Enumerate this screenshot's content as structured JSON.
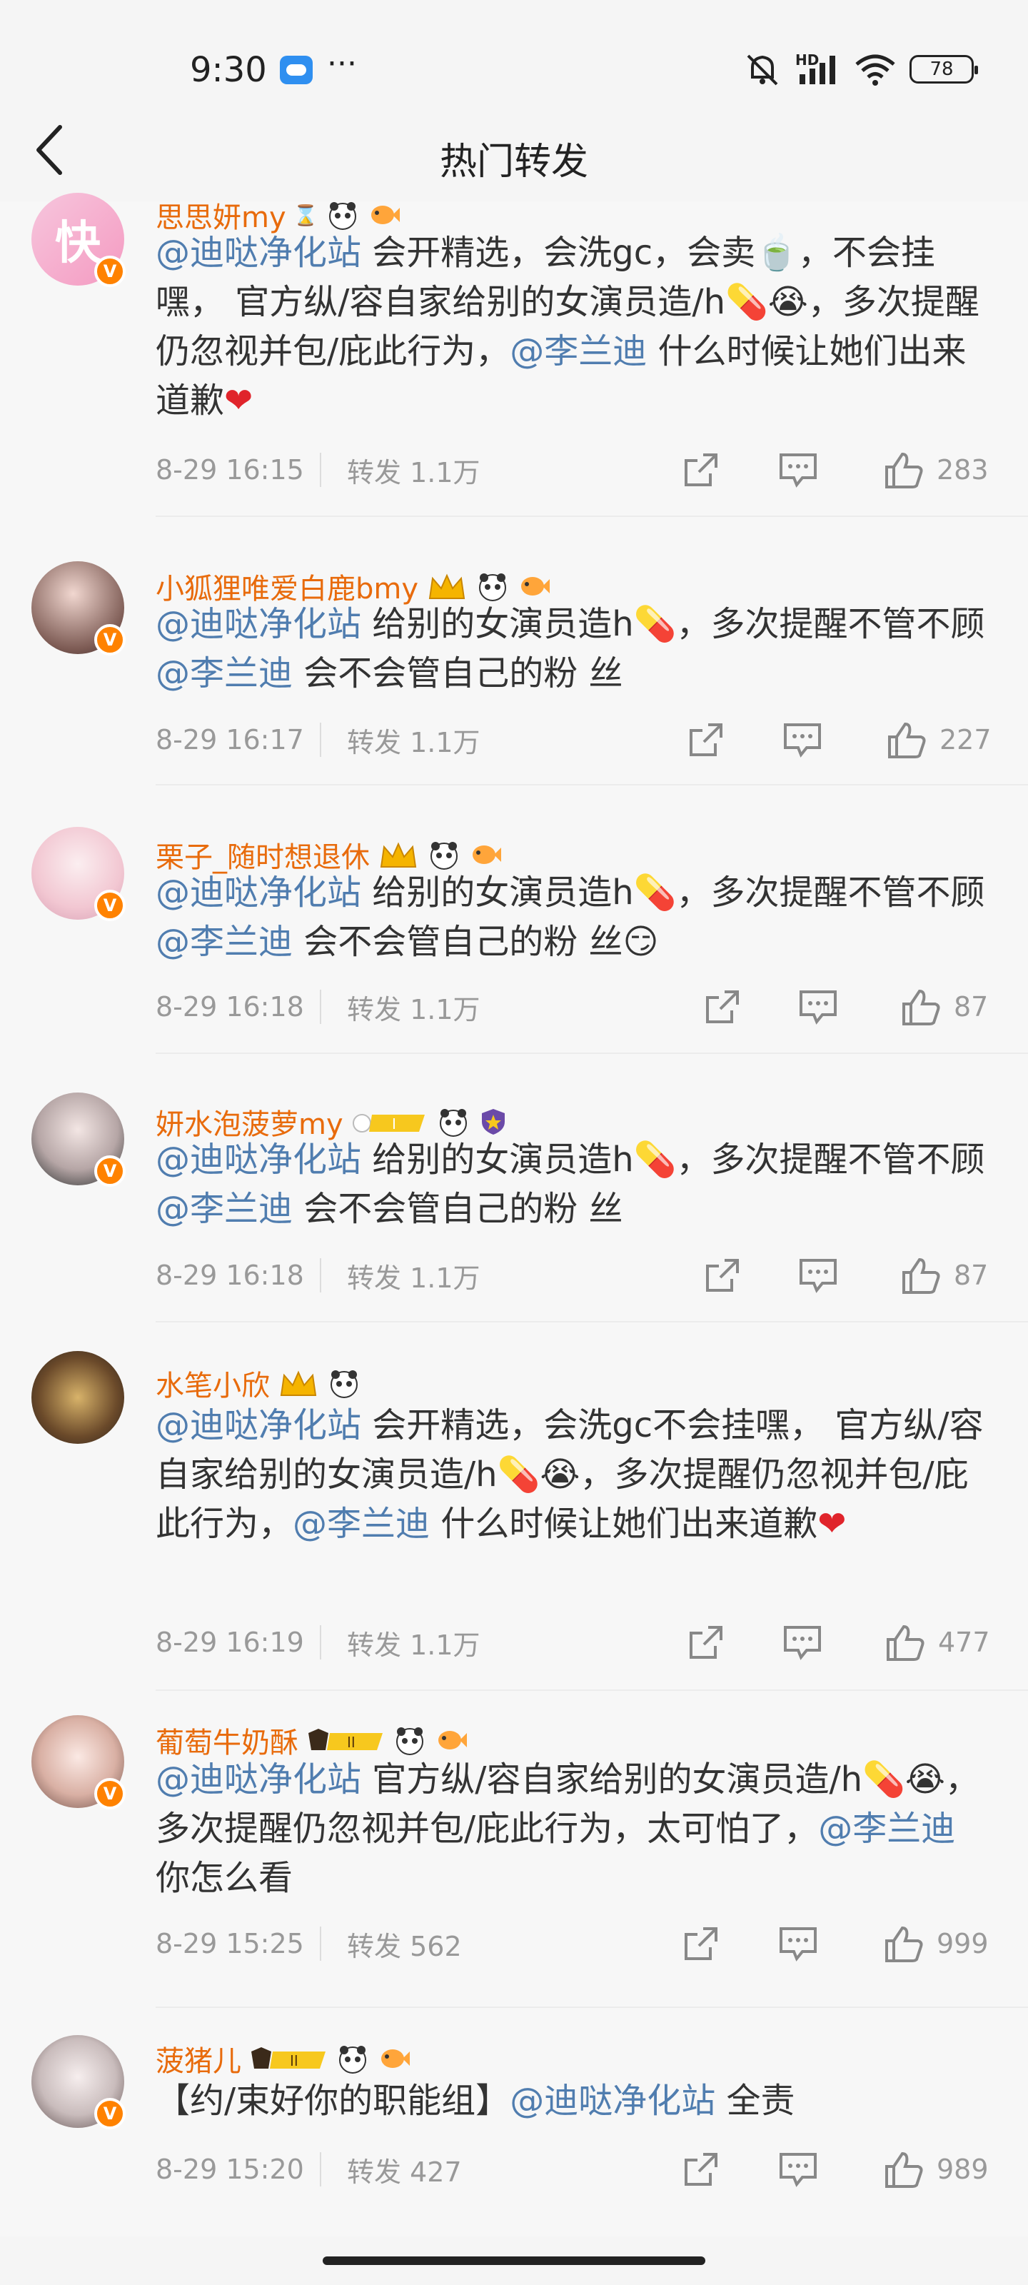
{
  "status": {
    "time": "9:30",
    "network": "HD",
    "battery": "78"
  },
  "nav": {
    "title": "热门转发"
  },
  "labels": {
    "repost_prefix": "转发"
  },
  "comments": [
    {
      "username": "思思妍my",
      "badges": [
        "hourglass-icon",
        "panda-icon",
        "fish-icon"
      ],
      "time": "8-29 16:15",
      "reposts": "1.1万",
      "likes": "283"
    },
    {
      "username": "小狐狸唯爱白鹿bmy",
      "badges": [
        "crown-icon",
        "panda-icon",
        "fish-icon"
      ],
      "time": "8-29 16:17",
      "reposts": "1.1万",
      "likes": "227"
    },
    {
      "username": "栗子_随时想退休",
      "badges": [
        "crown-icon",
        "panda-icon",
        "fish-icon"
      ],
      "time": "8-29 16:18",
      "reposts": "1.1万",
      "likes": "87"
    },
    {
      "username": "妍水泡菠萝my",
      "badges": [
        "level-badge-icon",
        "panda-icon",
        "shield-icon"
      ],
      "time": "8-29 16:18",
      "reposts": "1.1万",
      "likes": "87"
    },
    {
      "username": "水笔小欣",
      "badges": [
        "crown-icon",
        "panda-icon"
      ],
      "time": "8-29 16:19",
      "reposts": "1.1万",
      "likes": "477"
    },
    {
      "username": "葡萄牛奶酥",
      "badges": [
        "vip-ii-badge-icon",
        "panda-icon",
        "fish-icon"
      ],
      "time": "8-29 15:25",
      "reposts": "562",
      "likes": "999"
    },
    {
      "username": "菠猪儿",
      "badges": [
        "vip-ii-badge-icon",
        "panda-icon",
        "fish-icon"
      ],
      "time": "8-29 15:20",
      "reposts": "427",
      "likes": "989"
    }
  ],
  "text": {
    "c0": {
      "m1": "@迪哒净化站",
      "t1": " 会开精选，会洗gc，会卖",
      "t2": "，不会挂嘿，  官方纵/容自家给别的女演员造/h",
      "t3": "，多次提醒仍忽视并包/庇此行为，",
      "m2": "@李兰迪",
      "t4": " 什么时候让她们出来道歉"
    },
    "c1": {
      "m1": "@迪哒净化站",
      "t1": " 给别的女演员造h",
      "t2": "，多次提醒不管不顾",
      "m2": "@李兰迪",
      "t3": " 会不会管自己的粉  丝"
    },
    "c2": {
      "m1": "@迪哒净化站",
      "t1": " 给别的女演员造h",
      "t2": "，多次提醒不管不顾",
      "m2": "@李兰迪",
      "t3": " 会不会管自己的粉  丝"
    },
    "c3": {
      "m1": "@迪哒净化站",
      "t1": " 给别的女演员造h",
      "t2": "，多次提醒不管不顾",
      "m2": "@李兰迪",
      "t3": " 会不会管自己的粉  丝"
    },
    "c4": {
      "m1": "@迪哒净化站",
      "t1": " 会开精选，会洗gc不会挂嘿，  官方纵/容自家给别的女演员造/h",
      "t2": "，多次提醒仍忽视并包/庇此行为，",
      "m2": "@李兰迪",
      "t3": " 什么时候让她们出来道歉"
    },
    "c5": {
      "m1": "@迪哒净化站",
      "t1": " 官方纵/容自家给别的女演员造/h",
      "t2": "，多次提醒仍忽视并包/庇此行为，太可怕了，",
      "m2": "@李兰迪",
      "t3": " 你怎么看"
    },
    "c6": {
      "t0": "【约/束好你的职能组】",
      "m1": "@迪哒净化站",
      "t1": " 全责"
    }
  },
  "colors": {
    "username": "#e86b0c",
    "mention": "#507daf",
    "verified": "#ff8200",
    "background": "#f7f7f7"
  }
}
